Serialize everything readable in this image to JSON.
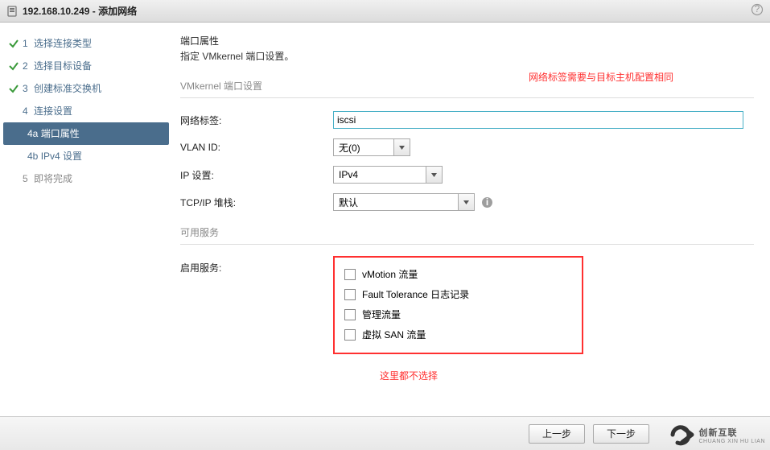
{
  "title": {
    "ip": "192.168.10.249",
    "suffix": " - 添加网络"
  },
  "sidebar": {
    "steps": [
      {
        "num": "1",
        "label": "选择连接类型",
        "done": true
      },
      {
        "num": "2",
        "label": "选择目标设备",
        "done": true
      },
      {
        "num": "3",
        "label": "创建标准交换机",
        "done": true
      },
      {
        "num": "4",
        "label": "连接设置",
        "done": false
      },
      {
        "num": "5",
        "label": "即将完成",
        "disabled": true
      }
    ],
    "substeps": [
      {
        "id": "4a",
        "label": "端口属性",
        "active": true
      },
      {
        "id": "4b",
        "label": "IPv4 设置",
        "active": false
      }
    ]
  },
  "header": {
    "title": "端口属性",
    "subtitle": "指定 VMkernel 端口设置。"
  },
  "annotations": {
    "top": "网络标签需要与目标主机配置相同",
    "bottom": "这里都不选择"
  },
  "section": {
    "title": "VMkernel 端口设置"
  },
  "form": {
    "netlabel": {
      "label": "网络标签:",
      "value": "iscsi"
    },
    "vlan": {
      "label": "VLAN ID:",
      "value": "无(0)"
    },
    "ip": {
      "label": "IP 设置:",
      "value": "IPv4"
    },
    "tcpip": {
      "label": "TCP/IP 堆栈:",
      "value": "默认"
    }
  },
  "services": {
    "section": "可用服务",
    "label": "启用服务:",
    "items": [
      "vMotion 流量",
      "Fault Tolerance 日志记录",
      "管理流量",
      "虚拟 SAN 流量"
    ]
  },
  "footer": {
    "back": "上一步",
    "next": "下一步"
  },
  "watermark": {
    "brand": "创新互联",
    "pinyin": "CHUANG XIN HU LIAN"
  }
}
